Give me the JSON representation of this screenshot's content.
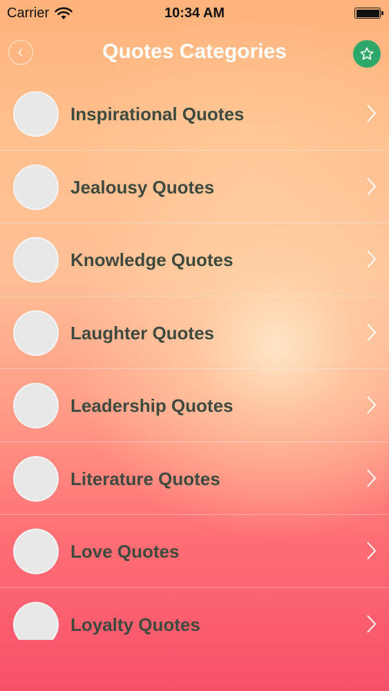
{
  "status_bar": {
    "carrier": "Carrier",
    "time": "10:34 AM"
  },
  "nav": {
    "title": "Quotes Categories",
    "back_icon": "chevron-left-icon",
    "favorite_icon": "star-icon",
    "favorite_color": "#2ea86a"
  },
  "categories": [
    {
      "label": "Inspirational Quotes"
    },
    {
      "label": "Jealousy Quotes"
    },
    {
      "label": "Knowledge Quotes"
    },
    {
      "label": "Laughter Quotes"
    },
    {
      "label": "Leadership Quotes"
    },
    {
      "label": "Literature Quotes"
    },
    {
      "label": "Love Quotes"
    },
    {
      "label": "Loyalty Quotes"
    }
  ],
  "colors": {
    "label_text": "#3f4a3f",
    "title_text": "#ffffff",
    "thumbnail": "#e8e8e8"
  }
}
